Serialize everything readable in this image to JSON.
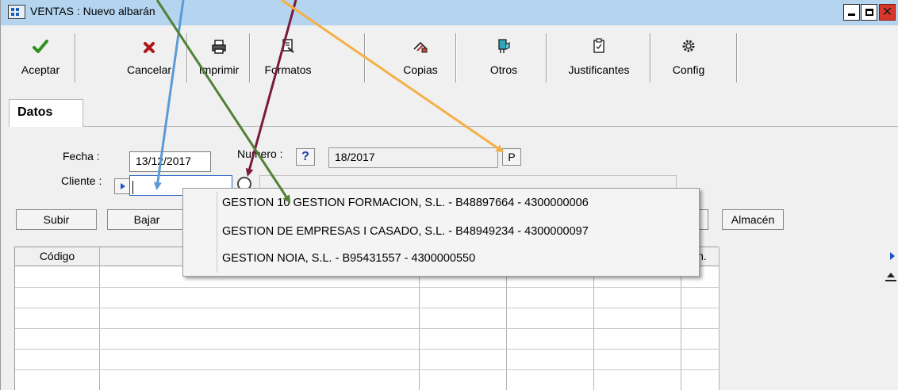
{
  "window": {
    "title": "VENTAS : Nuevo albarán"
  },
  "toolbar": {
    "buttons": [
      {
        "label": "Aceptar",
        "icon": "checkmark-icon",
        "color": "#2f8f1f"
      },
      {
        "label": "Cancelar",
        "icon": "x-cross-icon",
        "color": "#b01818"
      },
      {
        "label": "Imprimir",
        "icon": "printer-icon"
      },
      {
        "label": "Formatos",
        "icon": "formats-icon"
      },
      {
        "label": "Copias",
        "icon": "copies-icon"
      },
      {
        "label": "Otros",
        "icon": "others-icon"
      },
      {
        "label": "Justificantes",
        "icon": "clipboard-icon"
      },
      {
        "label": "Config",
        "icon": "gear-icon"
      }
    ]
  },
  "tabs": {
    "active": "Datos"
  },
  "form": {
    "fecha_label": "Fecha :",
    "fecha_value": "13/12/2017",
    "numero_label": "Numero :",
    "numero_help": "?",
    "numero_value": "18/2017",
    "numero_p": "P",
    "cliente_label": "Cliente :",
    "cliente_value": ""
  },
  "actions": {
    "subir": "Subir",
    "bajar": "Bajar",
    "almacen": "Almacén"
  },
  "grid": {
    "columns": [
      "Código",
      "",
      "",
      "",
      "",
      "m."
    ]
  },
  "autocomplete": {
    "items": [
      "GESTION 10 GESTION FORMACION, S.L.  -  B48897664  -  4300000006",
      "GESTION DE EMPRESAS I CASADO, S.L.  -  B48949234  -  4300000097",
      "GESTION NOIA, S.L.  -  B95431557  -  4300000550"
    ]
  },
  "annotation_colors": {
    "blue": "#5b9bd5",
    "dark_red": "#7b1a3a",
    "green": "#538135",
    "orange": "#f4b046"
  }
}
